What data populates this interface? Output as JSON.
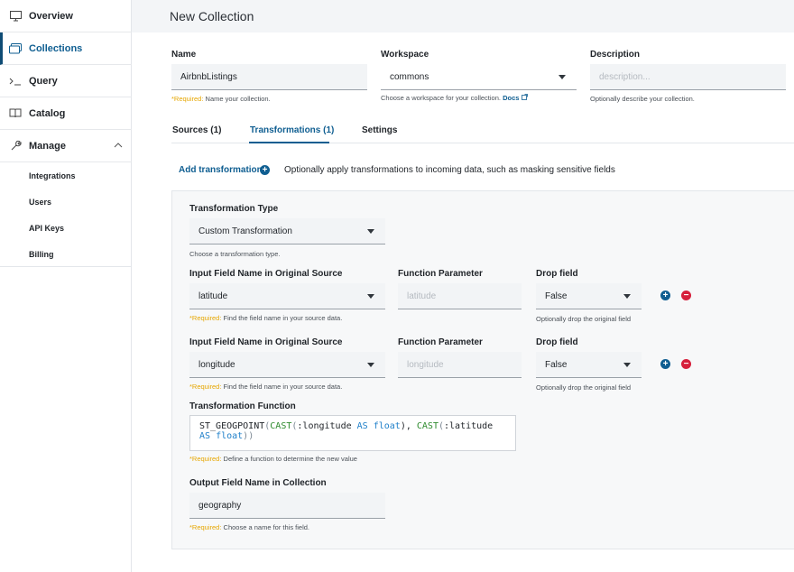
{
  "sidebar": {
    "items": [
      {
        "label": "Overview",
        "icon": "monitor-icon"
      },
      {
        "label": "Collections",
        "icon": "collections-icon"
      },
      {
        "label": "Query",
        "icon": "terminal-icon"
      },
      {
        "label": "Catalog",
        "icon": "book-icon"
      },
      {
        "label": "Manage",
        "icon": "wrench-icon"
      }
    ],
    "sub_items": [
      "Integrations",
      "Users",
      "API Keys",
      "Billing"
    ]
  },
  "header": {
    "title": "New Collection"
  },
  "form": {
    "name": {
      "label": "Name",
      "value": "AirbnbListings",
      "help_req": "*Required:",
      "help_text": "Name your collection."
    },
    "workspace": {
      "label": "Workspace",
      "value": "commons",
      "help_text": "Choose a workspace for your collection.",
      "docs": "Docs"
    },
    "description": {
      "label": "Description",
      "placeholder": "description...",
      "help_text": "Optionally describe your collection."
    }
  },
  "tabs": [
    {
      "label": "Sources (1)"
    },
    {
      "label": "Transformations (1)"
    },
    {
      "label": "Settings"
    }
  ],
  "add_transformation": {
    "label": "Add transformation",
    "description": "Optionally apply transformations to incoming data, such as masking sensitive fields"
  },
  "transformation": {
    "type_label": "Transformation Type",
    "type_value": "Custom Transformation",
    "type_help": "Choose a transformation type.",
    "input_label": "Input Field Name in Original Source",
    "param_label": "Function Parameter",
    "drop_label": "Drop field",
    "input_help_req": "*Required:",
    "input_help_text": "Find the field name in your source data.",
    "drop_help": "Optionally drop the original field",
    "rows": [
      {
        "input": "latitude",
        "param": "latitude",
        "drop": "False"
      },
      {
        "input": "longitude",
        "param": "longitude",
        "drop": "False"
      }
    ],
    "function_label": "Transformation Function",
    "function_help_req": "*Required:",
    "function_help_text": "Define a function to determine the new value",
    "output_label": "Output Field Name in Collection",
    "output_value": "geography",
    "output_help_req": "*Required:",
    "output_help_text": "Choose a name for this field."
  },
  "code": {
    "t1": "ST_GEOGPOINT",
    "t2": "(",
    "t3": "CAST",
    "t4": "(",
    "t5": ":longitude",
    "t6": " AS ",
    "t7": "float",
    "t8": "), ",
    "t9": "CAST",
    "t10": "(",
    "t11": ":latitude",
    "t12": "AS ",
    "t13": "float",
    "t14": "))"
  }
}
